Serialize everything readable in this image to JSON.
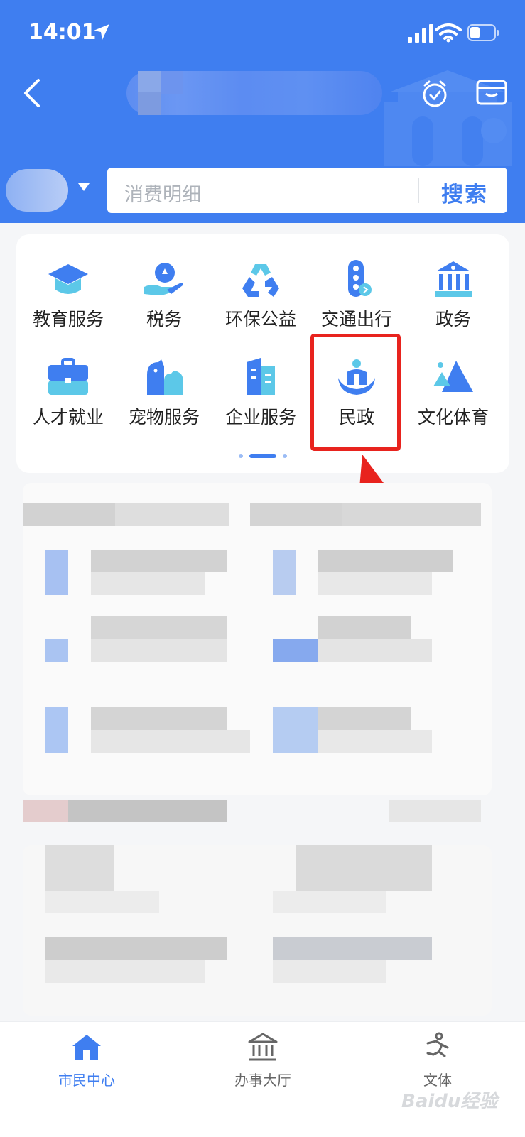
{
  "status_bar": {
    "time": "14:01"
  },
  "search": {
    "placeholder": "消费明细",
    "button": "搜索"
  },
  "services": [
    {
      "label": "教育服务",
      "icon": "graduation-cap-icon"
    },
    {
      "label": "税务",
      "icon": "tax-hand-icon"
    },
    {
      "label": "环保公益",
      "icon": "recycle-icon"
    },
    {
      "label": "交通出行",
      "icon": "traffic-light-icon"
    },
    {
      "label": "政务",
      "icon": "government-building-icon"
    },
    {
      "label": "人才就业",
      "icon": "briefcase-icon"
    },
    {
      "label": "宠物服务",
      "icon": "pets-icon"
    },
    {
      "label": "企业服务",
      "icon": "office-building-icon"
    },
    {
      "label": "民政",
      "icon": "civil-affairs-icon"
    },
    {
      "label": "文化体育",
      "icon": "mountain-icon"
    }
  ],
  "tabbar": {
    "items": [
      {
        "label": "市民中心",
        "active": true
      },
      {
        "label": "办事大厅",
        "active": false
      },
      {
        "label": "文体",
        "active": false
      }
    ]
  },
  "watermark": "Baidu经验",
  "colors": {
    "brand_blue": "#3f7ef0",
    "highlight_red": "#e8231e"
  }
}
